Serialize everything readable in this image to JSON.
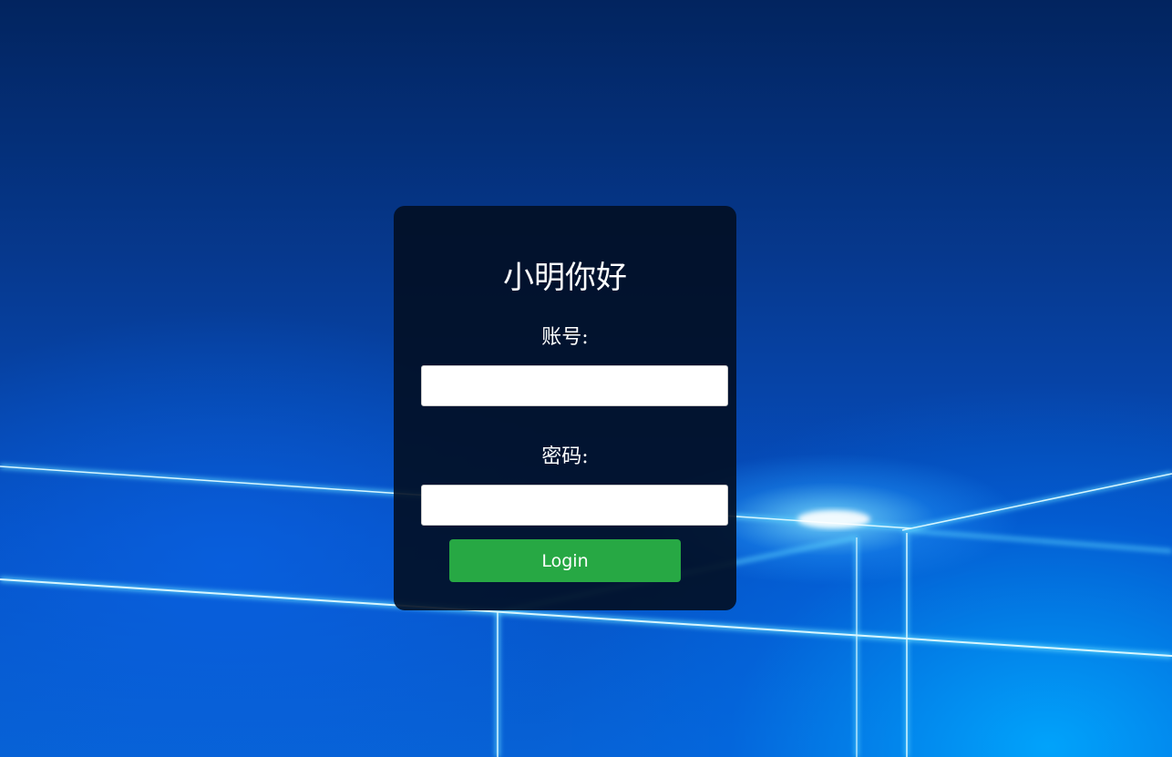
{
  "login": {
    "title": "小明你好",
    "username_label": "账号:",
    "username_value": "",
    "password_label": "密码:",
    "password_value": "",
    "submit_label": "Login"
  },
  "colors": {
    "card_background": "#020e22",
    "button": "#27a844",
    "button_text": "#ffffff",
    "text": "#ffffff",
    "wallpaper": "#0a3a8c"
  }
}
